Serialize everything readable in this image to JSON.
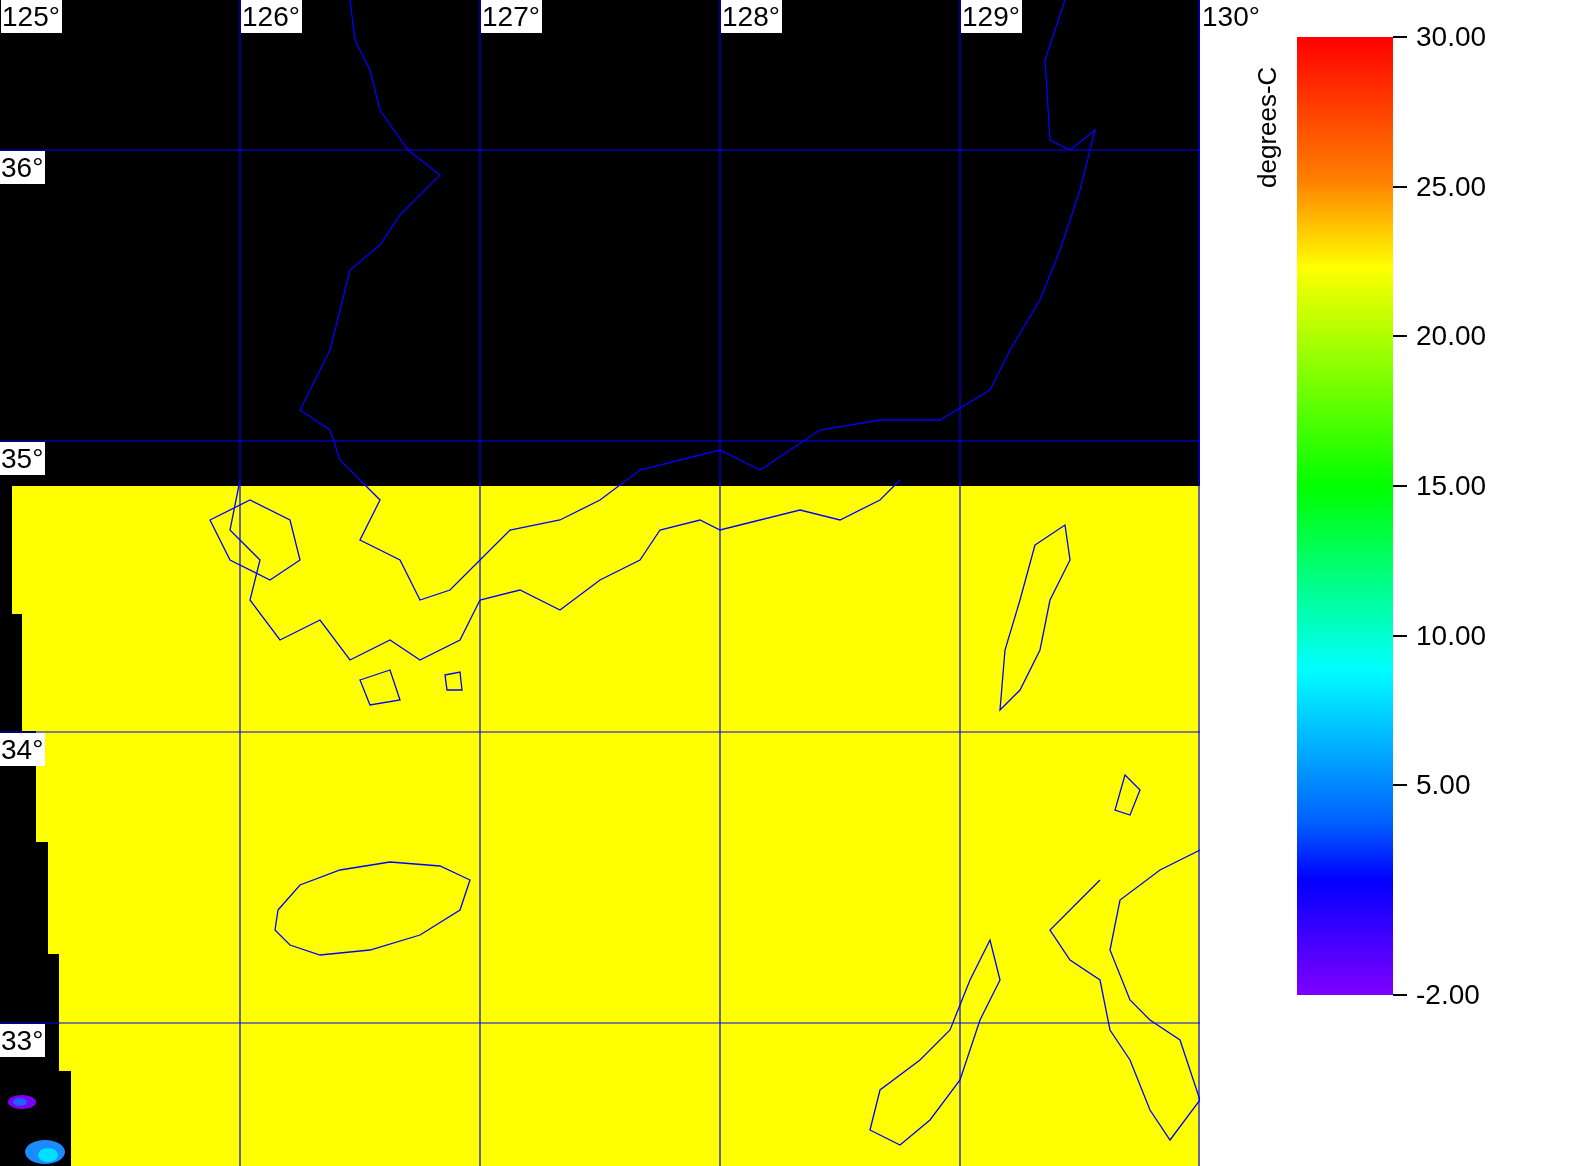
{
  "map": {
    "lon_labels": [
      "125°",
      "126°",
      "127°",
      "128°",
      "129°",
      "130°"
    ],
    "lat_labels": [
      "36°",
      "35°",
      "34°",
      "33°"
    ]
  },
  "colorbar": {
    "title": "degrees-C",
    "tick_labels": [
      "30.00",
      "25.00",
      "20.00",
      "15.00",
      "10.00",
      "5.00",
      "-2.00"
    ]
  }
}
